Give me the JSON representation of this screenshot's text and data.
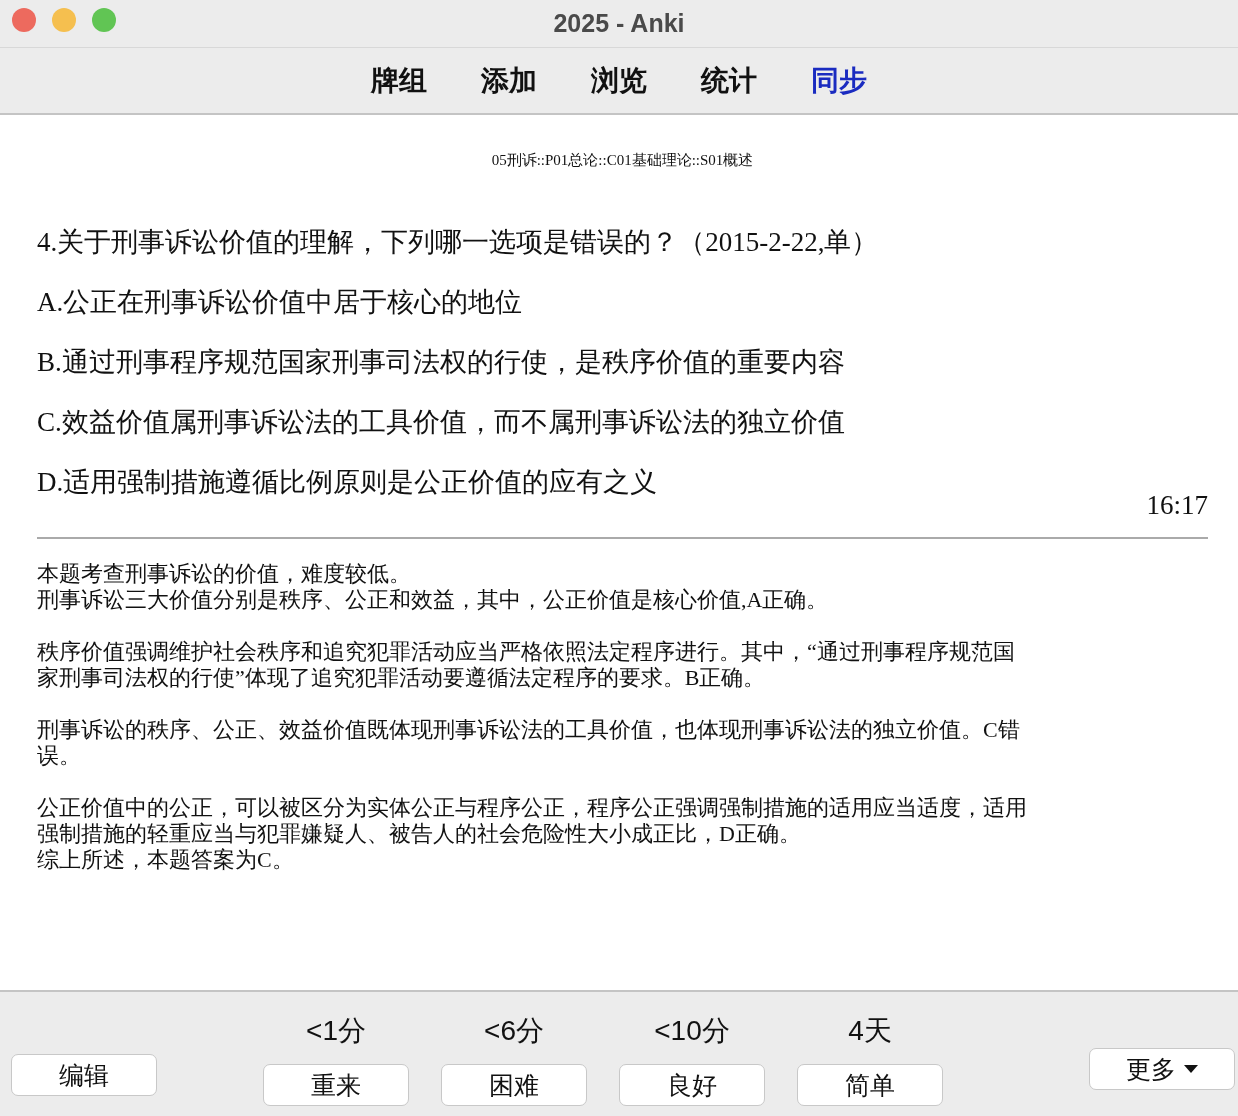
{
  "window": {
    "title": "2025 - Anki"
  },
  "toolbar": [
    {
      "label": "牌组",
      "attention": false
    },
    {
      "label": "添加",
      "attention": false
    },
    {
      "label": "浏览",
      "attention": false
    },
    {
      "label": "统计",
      "attention": false
    },
    {
      "label": "同步",
      "attention": true
    }
  ],
  "card": {
    "deck_path": "05刑诉::P01总论::C01基础理论::S01概述",
    "question": "4.关于刑事诉讼价值的理解，下列哪一选项是错误的？（2015-2-22,单）",
    "options": [
      "A.公正在刑事诉讼价值中居于核心的地位",
      "B.通过刑事程序规范国家刑事司法权的行使，是秩序价值的重要内容",
      "C.效益价值属刑事诉讼法的工具价值，而不属刑事诉讼法的独立价值",
      "D.适用强制措施遵循比例原则是公正价值的应有之义"
    ],
    "timer": "16:17",
    "explanation": [
      {
        "lines": [
          "本题考查刑事诉讼的价值，难度较低。",
          "刑事诉讼三大价值分别是秩序、公正和效益，其中，公正价值是核心价值,A正确。"
        ]
      },
      {
        "lines": [
          "秩序价值强调维护社会秩序和追究犯罪活动应当严格依照法定程序进行。其中，“通过刑事程序规范国",
          "家刑事司法权的行使”体现了追究犯罪活动要遵循法定程序的要求。B正确。"
        ]
      },
      {
        "lines": [
          "刑事诉讼的秩序、公正、效益价值既体现刑事诉讼法的工具价值，也体现刑事诉讼法的独立价值。C错",
          "误。"
        ]
      },
      {
        "lines": [
          "公正价值中的公正，可以被区分为实体公正与程序公正，程序公正强调强制措施的适用应当适度，适用",
          "强制措施的轻重应当与犯罪嫌疑人、被告人的社会危险性大小成正比，D正确。",
          "综上所述，本题答案为C。"
        ]
      }
    ]
  },
  "bottom_bar": {
    "edit_button": "编辑",
    "answers": [
      {
        "interval": "<1分",
        "label": "重来"
      },
      {
        "interval": "<6分",
        "label": "困难"
      },
      {
        "interval": "<10分",
        "label": "良好"
      },
      {
        "interval": "4天",
        "label": "简单"
      }
    ],
    "more_button": "更多"
  }
}
